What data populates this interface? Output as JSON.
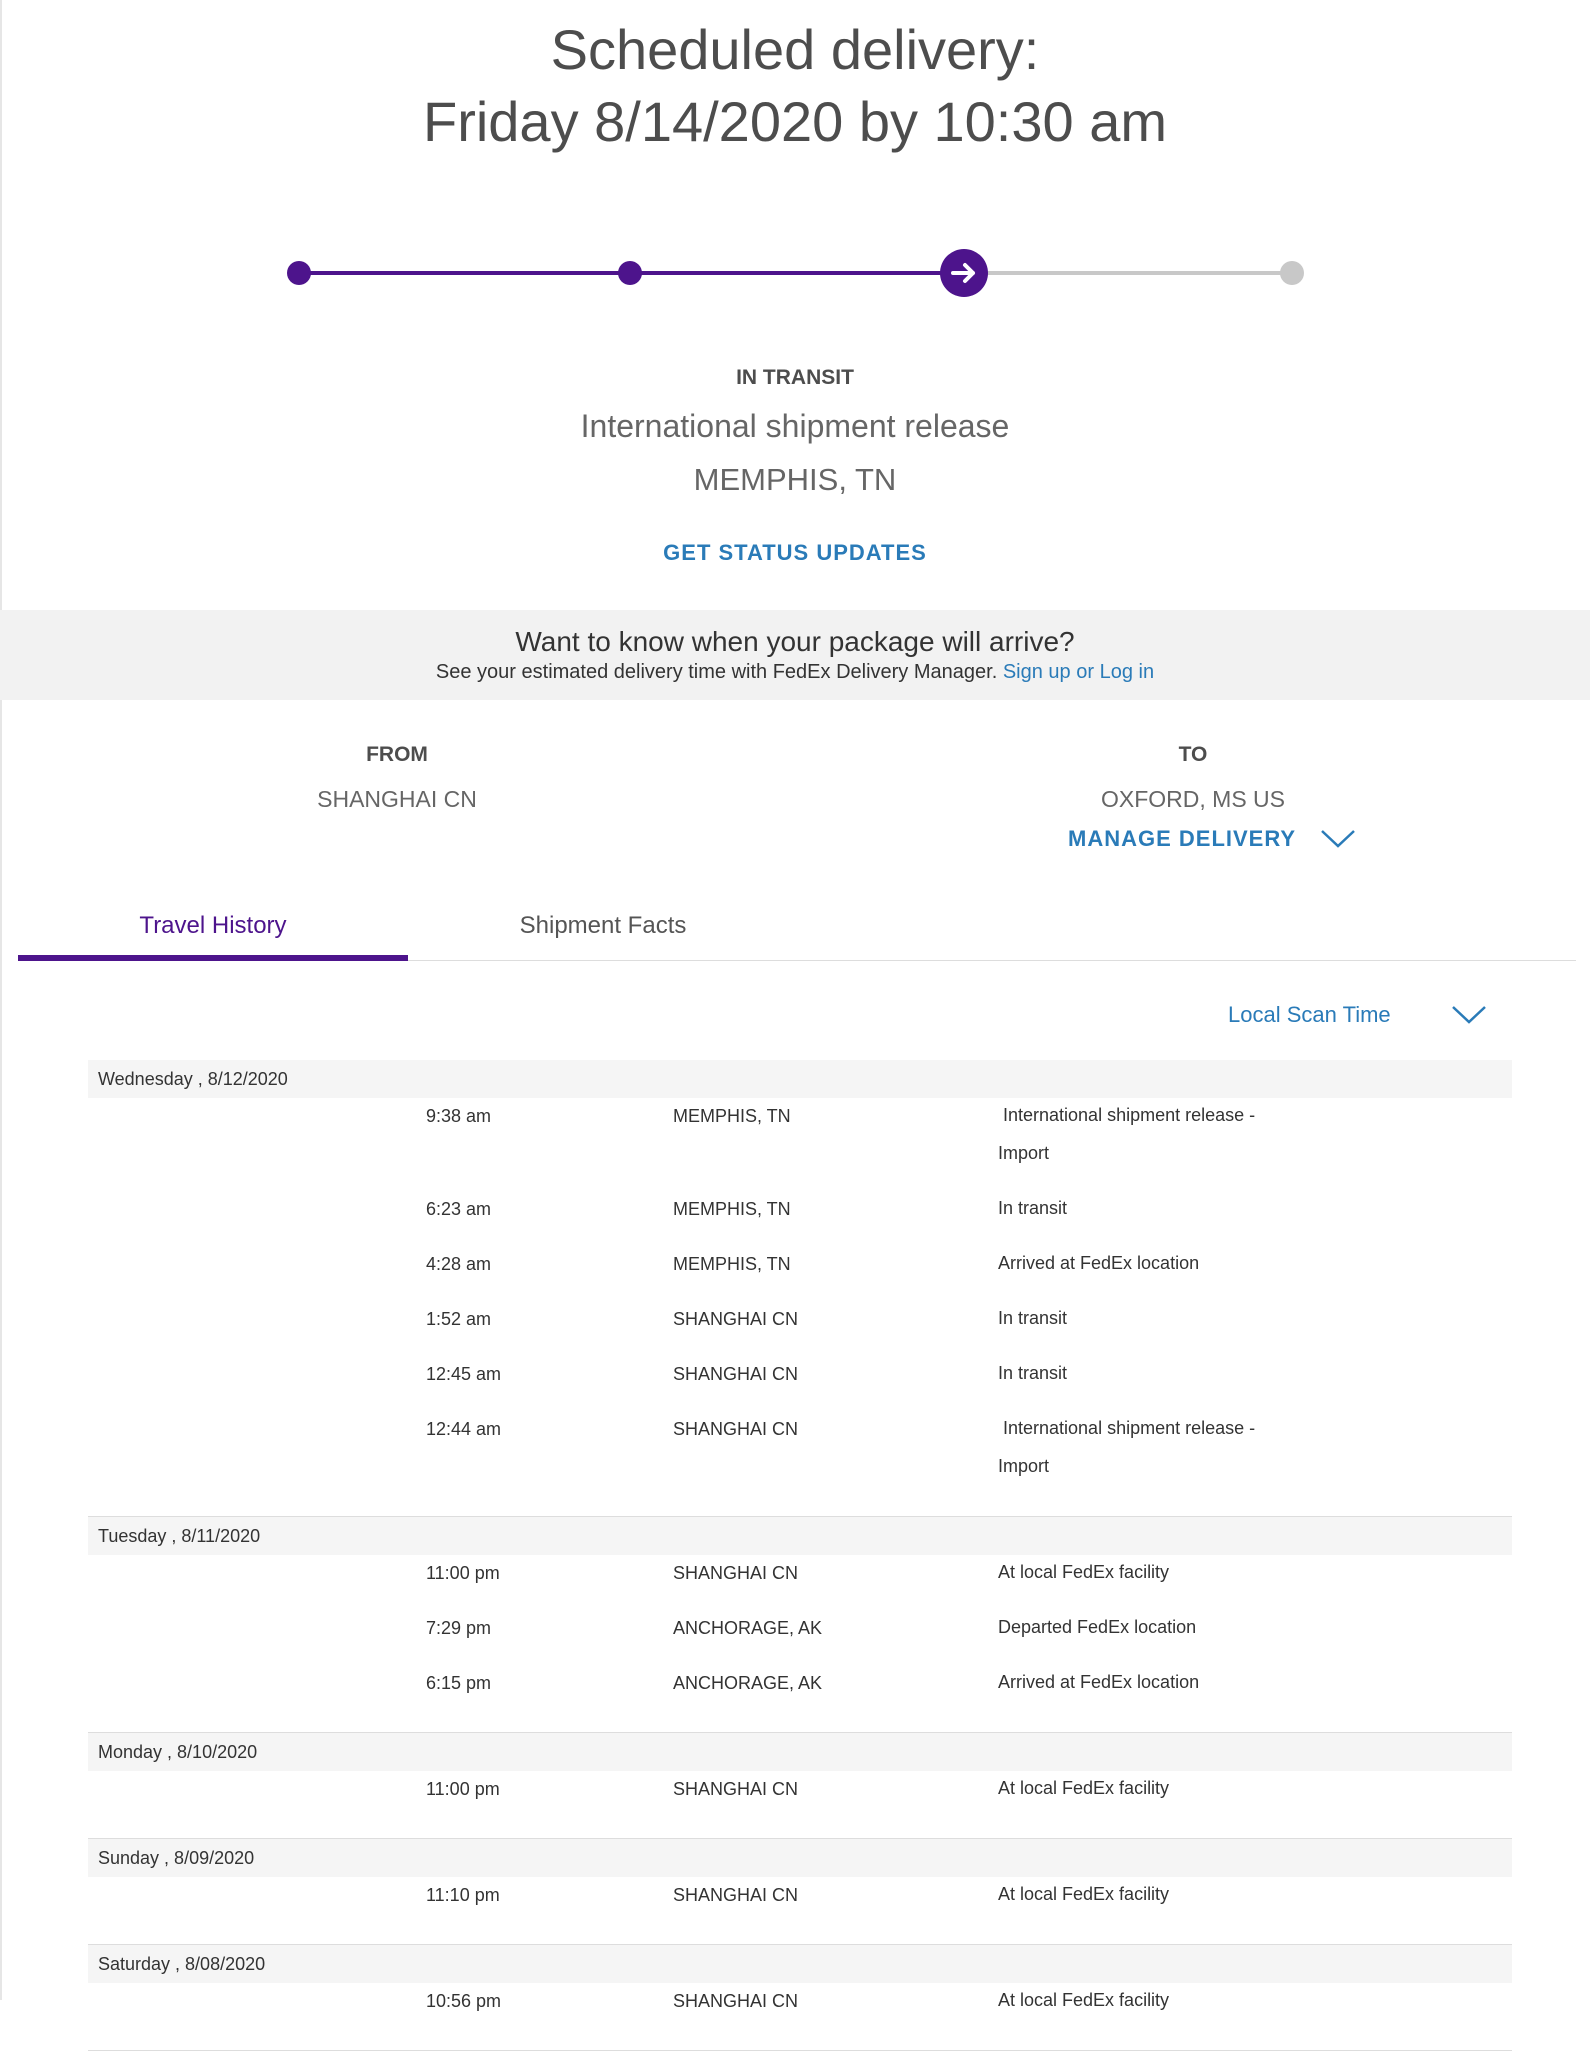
{
  "header": {
    "line1": "Scheduled delivery:",
    "line2": "Friday 8/14/2020 by 10:30 am"
  },
  "progress": {
    "steps_total": 4,
    "current_step": 3,
    "colors": {
      "done": "#4d148c",
      "pending": "#c8c8c8"
    }
  },
  "status": {
    "label": "IN TRANSIT",
    "description": "International shipment release",
    "location": "MEMPHIS, TN",
    "updates_link": "GET STATUS UPDATES"
  },
  "banner": {
    "title": "Want to know when your package will arrive?",
    "subtitle": "See your estimated delivery time with FedEx Delivery Manager.",
    "signup": "Sign up",
    "or": "or",
    "login": "Log in"
  },
  "route": {
    "from_label": "FROM",
    "from_value": "SHANGHAI CN",
    "to_label": "TO",
    "to_value": "OXFORD, MS US",
    "manage_delivery": "MANAGE DELIVERY"
  },
  "tabs": [
    {
      "label": "Travel History",
      "active": true
    },
    {
      "label": "Shipment Facts",
      "active": false
    }
  ],
  "scan_time_select": "Local Scan Time",
  "history": [
    {
      "day": "Wednesday , 8/12/2020",
      "scans": [
        {
          "time": "9:38 am",
          "location": "MEMPHIS, TN",
          "desc_line1": " International shipment release -",
          "desc_line2": "Import"
        },
        {
          "time": "6:23 am",
          "location": "MEMPHIS, TN",
          "desc_line1": "In transit"
        },
        {
          "time": "4:28 am",
          "location": "MEMPHIS, TN",
          "desc_line1": "Arrived at FedEx location"
        },
        {
          "time": "1:52 am",
          "location": "SHANGHAI CN",
          "desc_line1": "In transit"
        },
        {
          "time": "12:45 am",
          "location": "SHANGHAI CN",
          "desc_line1": "In transit"
        },
        {
          "time": "12:44 am",
          "location": "SHANGHAI CN",
          "desc_line1": " International shipment release -",
          "desc_line2": "Import"
        }
      ]
    },
    {
      "day": "Tuesday , 8/11/2020",
      "scans": [
        {
          "time": "11:00 pm",
          "location": "SHANGHAI CN",
          "desc_line1": "At local FedEx facility"
        },
        {
          "time": "7:29 pm",
          "location": "ANCHORAGE, AK",
          "desc_line1": "Departed FedEx location"
        },
        {
          "time": "6:15 pm",
          "location": "ANCHORAGE, AK",
          "desc_line1": "Arrived at FedEx location"
        }
      ]
    },
    {
      "day": "Monday , 8/10/2020",
      "scans": [
        {
          "time": "11:00 pm",
          "location": "SHANGHAI CN",
          "desc_line1": "At local FedEx facility"
        }
      ]
    },
    {
      "day": "Sunday , 8/09/2020",
      "scans": [
        {
          "time": "11:10 pm",
          "location": "SHANGHAI CN",
          "desc_line1": "At local FedEx facility"
        }
      ]
    },
    {
      "day": "Saturday , 8/08/2020",
      "scans": [
        {
          "time": "10:56 pm",
          "location": "SHANGHAI CN",
          "desc_line1": "At local FedEx facility"
        }
      ]
    }
  ],
  "icons": {
    "current_step": "arrow-right-icon",
    "chevron": "chevron-down-icon"
  }
}
